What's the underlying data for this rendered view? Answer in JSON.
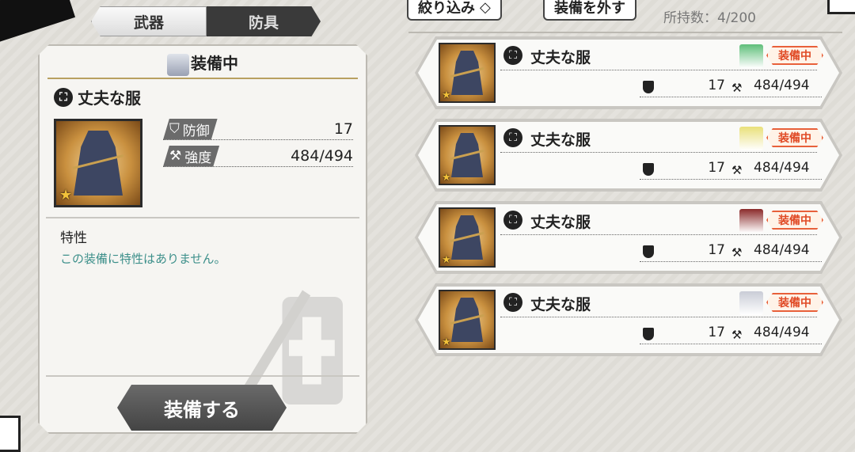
{
  "tabs": {
    "weapon": "武器",
    "armor": "防具"
  },
  "header": {
    "filter_label": "絞り込み",
    "filter_icon": "chevron-down-icon",
    "unequip_label": "装備を外す",
    "count_text": "所持数：4/200"
  },
  "detail": {
    "section_title": "装備中",
    "item_name": "丈夫な服",
    "stats": [
      {
        "label": "防御",
        "value": "17",
        "icon": "shield-icon"
      },
      {
        "label": "強度",
        "value": "484/494",
        "icon": "anvil-icon"
      }
    ],
    "trait_heading": "特性",
    "trait_text": "この装備に特性はありません。",
    "equip_button": "装備する"
  },
  "list": [
    {
      "name": "丈夫な服",
      "badge": "装備中",
      "defense": "17",
      "durability": "484/494",
      "avatar_color": "#5fbf7a"
    },
    {
      "name": "丈夫な服",
      "badge": "装備中",
      "defense": "17",
      "durability": "484/494",
      "avatar_color": "#e9e07a"
    },
    {
      "name": "丈夫な服",
      "badge": "装備中",
      "defense": "17",
      "durability": "484/494",
      "avatar_color": "#8a2a2a"
    },
    {
      "name": "丈夫な服",
      "badge": "装備中",
      "defense": "17",
      "durability": "484/494",
      "avatar_color": "#c9ccd6"
    }
  ],
  "colors": {
    "accent": "#e8603a",
    "trait_text": "#3c8f8a",
    "gold": "#b8a060"
  }
}
